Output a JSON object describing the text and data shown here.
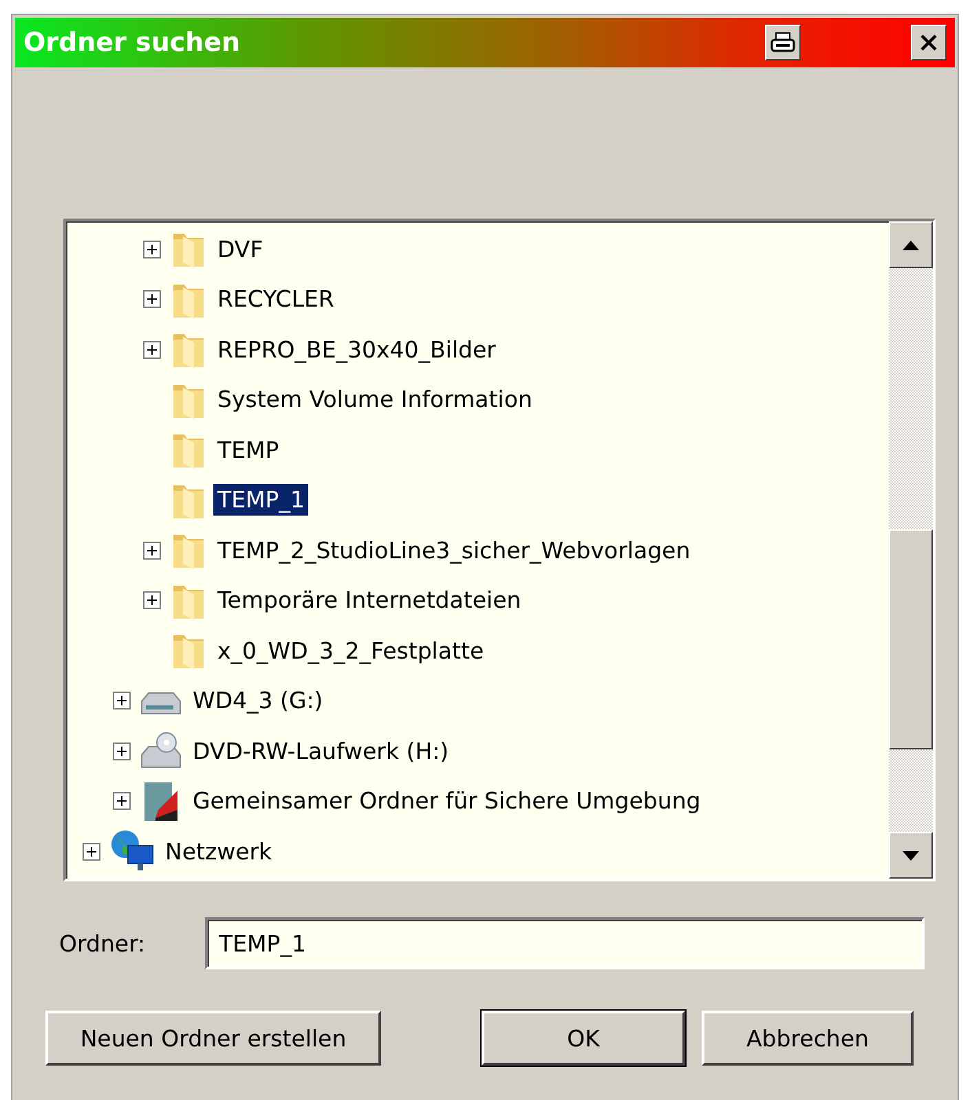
{
  "window": {
    "title": "Ordner suchen"
  },
  "tree": {
    "items": [
      {
        "children": [
          {
            "children": [
              {
                "label": "DVF",
                "kind": "folder",
                "expandable": true,
                "selected": false
              },
              {
                "label": "RECYCLER",
                "kind": "folder",
                "expandable": true,
                "selected": false
              },
              {
                "label": "REPRO_BE_30x40_Bilder",
                "kind": "folder",
                "expandable": true,
                "selected": false
              },
              {
                "label": "System Volume Information",
                "kind": "folder",
                "expandable": false,
                "selected": false
              },
              {
                "label": "TEMP",
                "kind": "folder",
                "expandable": false,
                "selected": false
              },
              {
                "label": "TEMP_1",
                "kind": "folder",
                "expandable": false,
                "selected": true
              },
              {
                "label": "TEMP_2_StudioLine3_sicher_Webvorlagen",
                "kind": "folder",
                "expandable": true,
                "selected": false
              },
              {
                "label": "Temporäre Internetdateien",
                "kind": "folder",
                "expandable": true,
                "selected": false
              },
              {
                "label": "x_0_WD_3_2_Festplatte",
                "kind": "folder",
                "expandable": false,
                "selected": false
              }
            ]
          },
          {
            "label": "WD4_3 (G:)",
            "kind": "drive",
            "expandable": true,
            "selected": false
          },
          {
            "label": "DVD-RW-Laufwerk (H:)",
            "kind": "dvd",
            "expandable": true,
            "selected": false
          },
          {
            "label": "Gemeinsamer Ordner für Sichere Umgebung",
            "kind": "shared",
            "expandable": true,
            "selected": false
          }
        ]
      },
      {
        "label": "Netzwerk",
        "kind": "network",
        "expandable": true,
        "selected": false
      }
    ]
  },
  "folder_field": {
    "label": "Ordner:",
    "value": "TEMP_1"
  },
  "buttons": [
    {
      "label": "Neuen Ordner erstellen",
      "default": false
    },
    {
      "label": "OK",
      "default": true
    },
    {
      "label": "Abbrechen",
      "default": false
    }
  ]
}
